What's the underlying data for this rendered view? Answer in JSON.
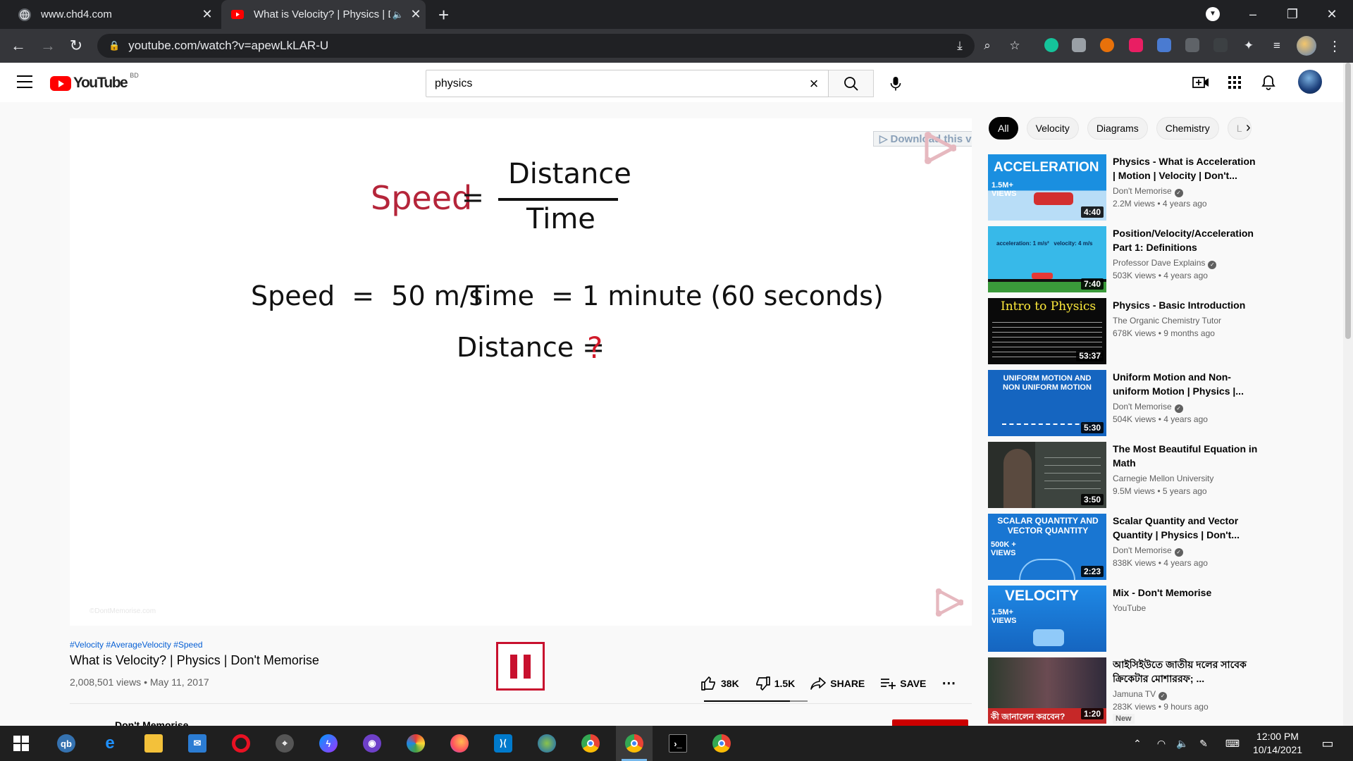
{
  "browser": {
    "tabs": [
      {
        "title": "www.chd4.com",
        "active": false
      },
      {
        "title": "What is Velocity? | Physics | D",
        "active": true
      }
    ],
    "url": "youtube.com/watch?v=apewLkLAR-U",
    "window_controls": [
      "–",
      "❐",
      "✕"
    ]
  },
  "youtube": {
    "logo_text": "YouTube",
    "country_code": "BD",
    "search": {
      "query": "physics"
    }
  },
  "video": {
    "formula": {
      "speed": "Speed",
      "equals": "=",
      "numerator": "Distance",
      "denominator": "Time"
    },
    "given_speed": "Speed  =  50 m/s",
    "given_time": "Time  = 1 minute (60 seconds)",
    "distance_label": "Distance =",
    "question_mark": "?",
    "watermark": "©DontMemorise.com",
    "download_bar": "Download this video",
    "download_bar_ctrl": "? ✕"
  },
  "info": {
    "hashtags": "#Velocity #AverageVelocity #Speed",
    "title": "What is Velocity? | Physics | Don't Memorise",
    "views": "2,008,501 views",
    "date": "May 11, 2017",
    "likes": "38K",
    "dislikes": "1.5K",
    "share": "SHARE",
    "save": "SAVE",
    "like_ratio": 0.83,
    "channel_peek": "Don't Memorise"
  },
  "chips": [
    "All",
    "Velocity",
    "Diagrams",
    "Chemistry",
    "L"
  ],
  "recommendations": [
    {
      "title": "Physics - What is Acceleration | Motion | Velocity | Don't...",
      "channel": "Don't Memorise",
      "verified": true,
      "meta": "2.2M views • 4 years ago",
      "duration": "4:40",
      "thumb_text": "ACCELERATION",
      "thumb_sub": "1.5M+ VIEWS"
    },
    {
      "title": "Position/Velocity/Acceleration Part 1: Definitions",
      "channel": "Professor Dave Explains",
      "verified": true,
      "meta": "503K views • 4 years ago",
      "duration": "7:40",
      "thumb_text": "acceleration: 1 m/s²   velocity: 4 m/s",
      "thumb_sub": ""
    },
    {
      "title": "Physics - Basic Introduction",
      "channel": "The Organic Chemistry Tutor",
      "verified": false,
      "meta": "678K views • 9 months ago",
      "duration": "53:37",
      "thumb_text": "Intro to Physics",
      "thumb_sub": ""
    },
    {
      "title": "Uniform Motion and Non-uniform Motion | Physics |...",
      "channel": "Don't Memorise",
      "verified": true,
      "meta": "504K views • 4 years ago",
      "duration": "5:30",
      "thumb_text": "UNIFORM MOTION AND NON UNIFORM MOTION",
      "thumb_sub": ""
    },
    {
      "title": "The Most Beautiful Equation in Math",
      "channel": "Carnegie Mellon University",
      "verified": false,
      "meta": "9.5M views • 5 years ago",
      "duration": "3:50",
      "thumb_text": "",
      "thumb_sub": ""
    },
    {
      "title": "Scalar Quantity and Vector Quantity | Physics | Don't...",
      "channel": "Don't Memorise",
      "verified": true,
      "meta": "838K views • 4 years ago",
      "duration": "2:23",
      "thumb_text": "SCALAR QUANTITY AND VECTOR QUANTITY",
      "thumb_sub": "500K + VIEWS"
    },
    {
      "title": "Mix - Don't Memorise",
      "channel": "YouTube",
      "verified": false,
      "meta": "",
      "duration": "",
      "thumb_text": "VELOCITY",
      "thumb_sub": "1.5M+ VIEWS"
    },
    {
      "title": "আইসিইউতে জাতীয় দলের সাবেক ক্রিকেটার মোশাররফ; ...",
      "channel": "Jamuna TV",
      "verified": true,
      "meta": "283K views • 9 hours ago",
      "duration": "1:20",
      "thumb_text": "কী জানালেন করবেন?",
      "thumb_sub": "",
      "badge": "New"
    }
  ],
  "taskbar": {
    "time": "12:00 PM",
    "date": "10/14/2021"
  },
  "colors": {
    "yt_red": "#ff0000",
    "speed_red": "#b5253a",
    "chip_selected": "#030303",
    "link_blue": "#065fd4",
    "chrome_dark": "#202124"
  }
}
